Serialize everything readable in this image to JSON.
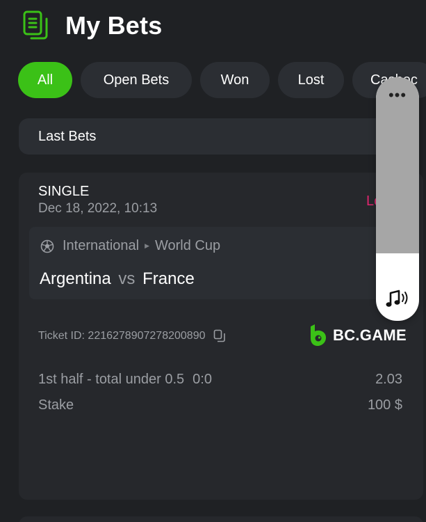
{
  "header": {
    "title": "My Bets",
    "icon": "bets-document-icon"
  },
  "tabs": [
    {
      "label": "All",
      "active": true
    },
    {
      "label": "Open Bets",
      "active": false
    },
    {
      "label": "Won",
      "active": false
    },
    {
      "label": "Lost",
      "active": false
    },
    {
      "label": "Cashec",
      "active": false
    }
  ],
  "filter": {
    "label": "Last Bets"
  },
  "bet": {
    "type": "SINGLE",
    "date": "Dec 18, 2022, 10:13",
    "status": "Lo",
    "league": {
      "sport_icon": "soccer-ball-icon",
      "region": "International",
      "competition": "World Cup"
    },
    "match": {
      "home": "Argentina",
      "vs": "vs",
      "away": "France"
    },
    "ticket_id": "Ticket ID: 2216278907278200890",
    "brand": "BC.GAME",
    "market": "1st half - total under 0.5",
    "score": "0:0",
    "odds": "2.03",
    "stake_label": "Stake",
    "stake_value": "100 $"
  },
  "overlay": {
    "menu": "•••",
    "icon": "music-note-volume-icon"
  },
  "colors": {
    "background": "#1f2124",
    "accent": "#3bc117",
    "status_lost": "#e0266f",
    "muted_text": "#9b9ea3"
  }
}
